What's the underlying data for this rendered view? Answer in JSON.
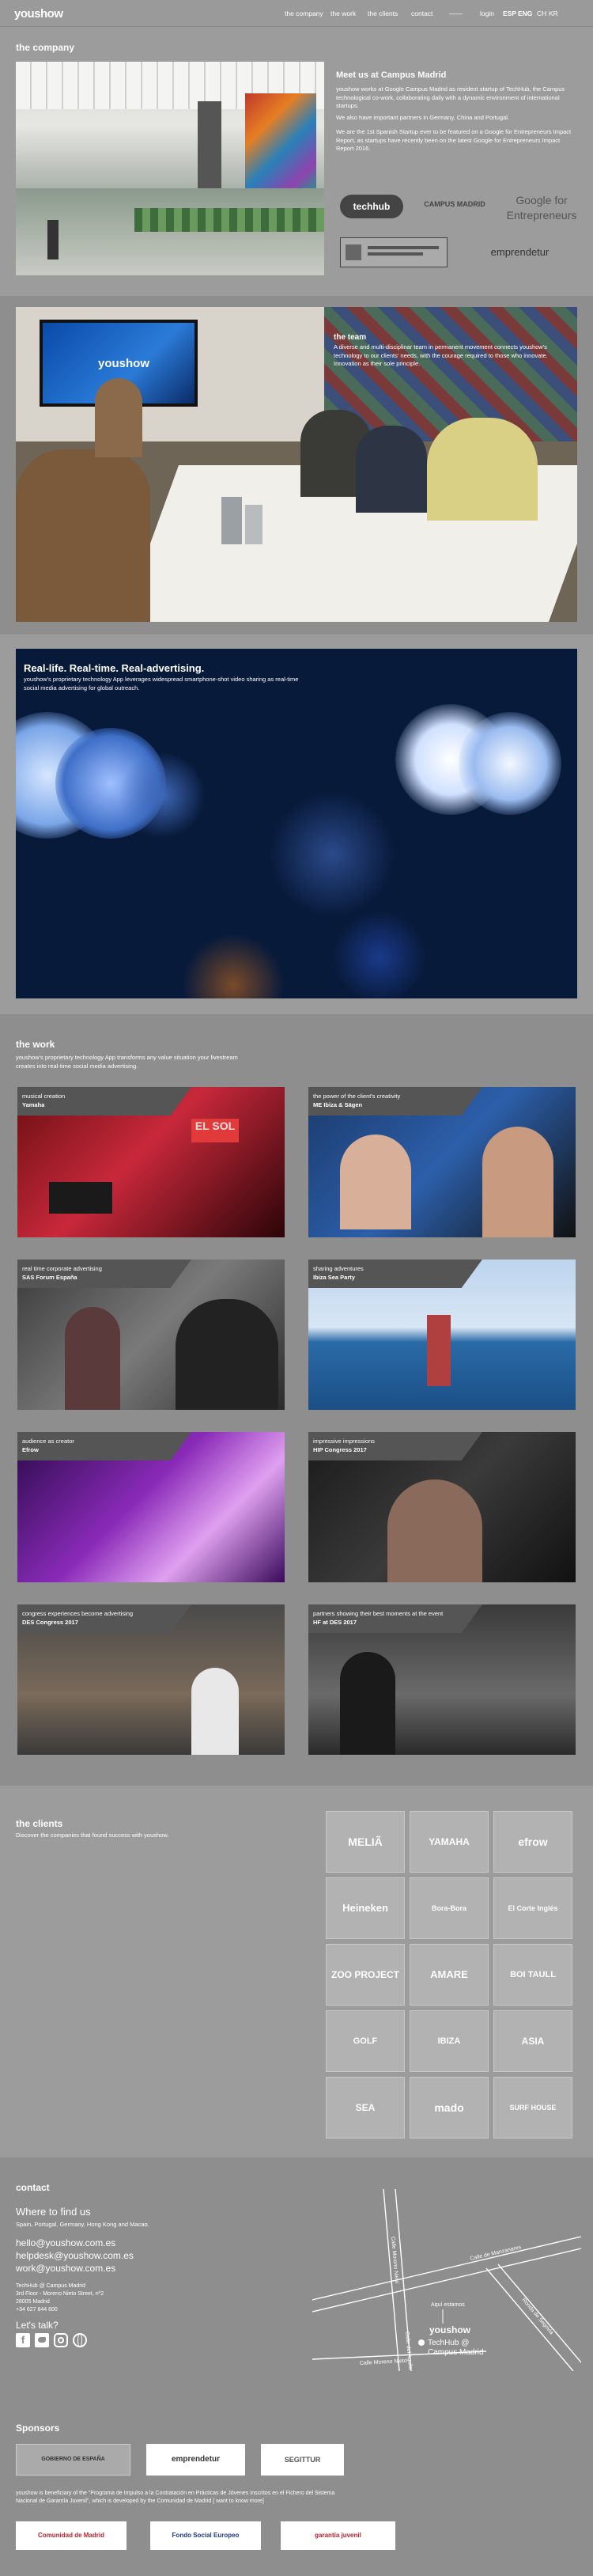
{
  "header": {
    "logo": "youshow",
    "nav": [
      "the company",
      "the work",
      "the clients",
      "contact"
    ],
    "dash": "——",
    "login": "login",
    "langs": [
      "ESP",
      "ENG",
      "CH",
      "KR"
    ]
  },
  "company": {
    "title": "the company",
    "heading": "Meet us at Campus Madrid",
    "p1": "youshow works at Google Campus Madrid as resident startup of TechHub, the Campus technological co-work, collaborating daily with a dynamic environment of international startups.",
    "p2": "We also have important partners in Germany, China and Portugal.",
    "p3": "We are the 1st Spanish Startup ever to be featured on a Google for Entrepreneurs Impact Report, as startups have recently been on the latest Google for Entrepreneurs Impact Report 2016.",
    "logos": [
      "techhub",
      "CAMPUS MADRID",
      "Google for Entrepreneurs",
      "emprendetur"
    ]
  },
  "team": {
    "title": "the team",
    "text": "A diverse and multi-disciplinar team in permanent movement connects youshow's technology to our clients' needs, with the courage required to those who innovate. Innovation as their sole principle.",
    "screen": "youshow"
  },
  "realtime": {
    "title": "Real-life. Real-time. Real-advertising.",
    "text": "youshow's proprietary technology App leverages widespread smartphone-shot video sharing as real-time social media advertising for global outreach."
  },
  "work": {
    "title": "the work",
    "intro": "youshow's proprietary technology App transforms any value situation your livestream creates into real-time social media advertising.",
    "tiles": [
      {
        "line1": "musical creation",
        "line2": "Yamaha"
      },
      {
        "line1": "the power of the client's creativity",
        "line2": "ME Ibiza & Sägen"
      },
      {
        "line1": "real time corporate advertising",
        "line2": "SAS Forum España"
      },
      {
        "line1": "sharing adventures",
        "line2": "Ibiza Sea Party"
      },
      {
        "line1": "audience as creator",
        "line2": "Efrow"
      },
      {
        "line1": "impressive impressions",
        "line2": "HIP Congress 2017"
      },
      {
        "line1": "congress experiences become advertising",
        "line2": "DES Congress 2017"
      },
      {
        "line1": "partners showing their best moments at the event",
        "line2": "HF at DES 2017"
      }
    ]
  },
  "clients": {
    "title": "the clients",
    "text": "Discover the companies that found success with youshow.",
    "logos": [
      "MELIÃ",
      "YAMAHA",
      "efrow",
      "Heineken",
      "Bora-Bora",
      "El Corte Inglés",
      "ZOO PROJECT",
      "AMARE",
      "BOI TAULL",
      "GOLF",
      "IBIZA",
      "ASIA",
      "SEA",
      "mado",
      "SURF HOUSE"
    ]
  },
  "contact": {
    "title": "contact",
    "where_title": "Where to find us",
    "where_text": "Spain, Portugal, Germany, Hong Kong and Macao.",
    "emails": [
      "hello@youshow.com.es",
      "helpdesk@youshow.com.es",
      "work@youshow.com.es"
    ],
    "address": [
      "TechHub @ Campus Madrid",
      "3rd Floor - Moreno Nieto Street, nº2",
      "28005 Madrid",
      "+34 627 844 600"
    ],
    "talk": "Let's talk?",
    "map": {
      "streets": [
        "Calle de Manzanares",
        "Calle Moreno Nieto",
        "Calle del Aguila",
        "Ronda de Segovia",
        "Calle Moreno Nieto"
      ],
      "pin_label": "Aquí estamos",
      "brand": "youshow",
      "place1": "TechHub @",
      "place2": "Campus Madrid"
    }
  },
  "sponsors": {
    "title": "Sponsors",
    "logos": [
      "GOBIERNO DE ESPAÑA",
      "emprendetur",
      "SEGITTUR"
    ],
    "text": "youshow is beneficiary of the \"Programa de Impulso a la Contratación en Prácticas de Jóvenes Inscritos en el Fichero del Sistema Nacional de Garantía Juvenil\", which is developed by the Comunidad de Madrid [ want to know more]",
    "bottom": [
      "Comunidad de Madrid",
      "Fondo Social Europeo",
      "garantía juvenil"
    ]
  },
  "colors": {
    "bg": "#9c9c9c",
    "dark": "#8e8e8e",
    "accent": "#1a3a8a"
  }
}
